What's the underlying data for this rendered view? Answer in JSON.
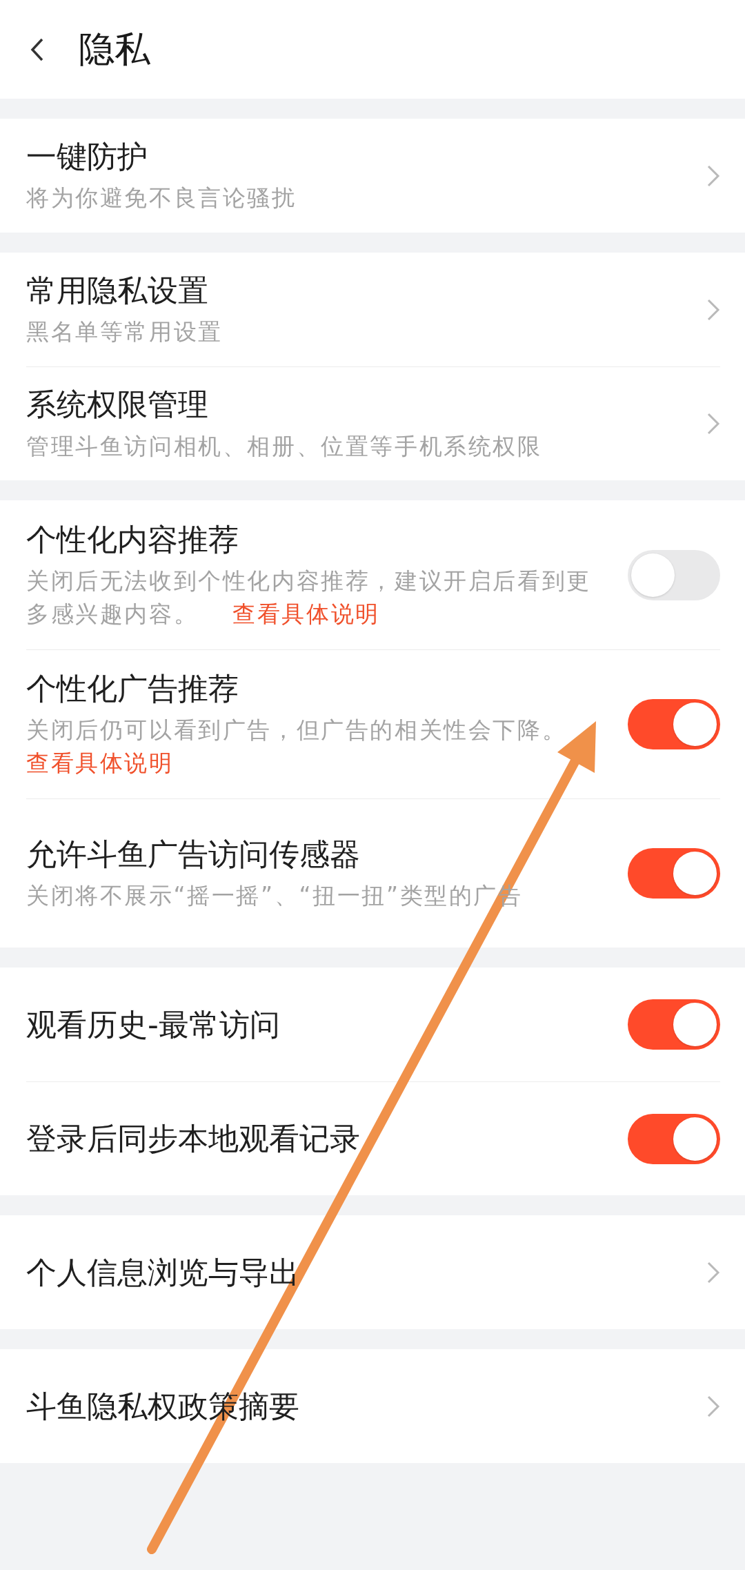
{
  "header": {
    "title": "隐私"
  },
  "sections": [
    {
      "rows": [
        {
          "kind": "nav",
          "title": "一键防护",
          "subtitle": "将为你避免不良言论骚扰"
        }
      ]
    },
    {
      "rows": [
        {
          "kind": "nav",
          "title": "常用隐私设置",
          "subtitle": "黑名单等常用设置"
        },
        {
          "kind": "nav",
          "title": "系统权限管理",
          "subtitle": "管理斗鱼访问相机、相册、位置等手机系统权限"
        }
      ]
    },
    {
      "rows": [
        {
          "kind": "toggle",
          "title": "个性化内容推荐",
          "subtitle": "关闭后无法收到个性化内容推荐，建议开启后看到更多感兴趣内容。",
          "link": "查看具体说明",
          "link_break": false,
          "on": false
        },
        {
          "kind": "toggle",
          "title": "个性化广告推荐",
          "subtitle": "关闭后仍可以看到广告，但广告的相关性会下降。",
          "link": "查看具体说明",
          "link_break": true,
          "on": true
        },
        {
          "kind": "toggle",
          "title": "允许斗鱼广告访问传感器",
          "subtitle": "关闭将不展示“摇一摇”、“扭一扭”类型的广告",
          "on": true
        }
      ]
    },
    {
      "rows": [
        {
          "kind": "toggle",
          "title": "观看历史-最常访问",
          "on": true
        },
        {
          "kind": "toggle",
          "title": "登录后同步本地观看记录",
          "on": true
        }
      ]
    },
    {
      "rows": [
        {
          "kind": "nav",
          "title": "个人信息浏览与导出"
        }
      ]
    },
    {
      "rows": [
        {
          "kind": "nav",
          "title": "斗鱼隐私权政策摘要"
        }
      ]
    }
  ]
}
